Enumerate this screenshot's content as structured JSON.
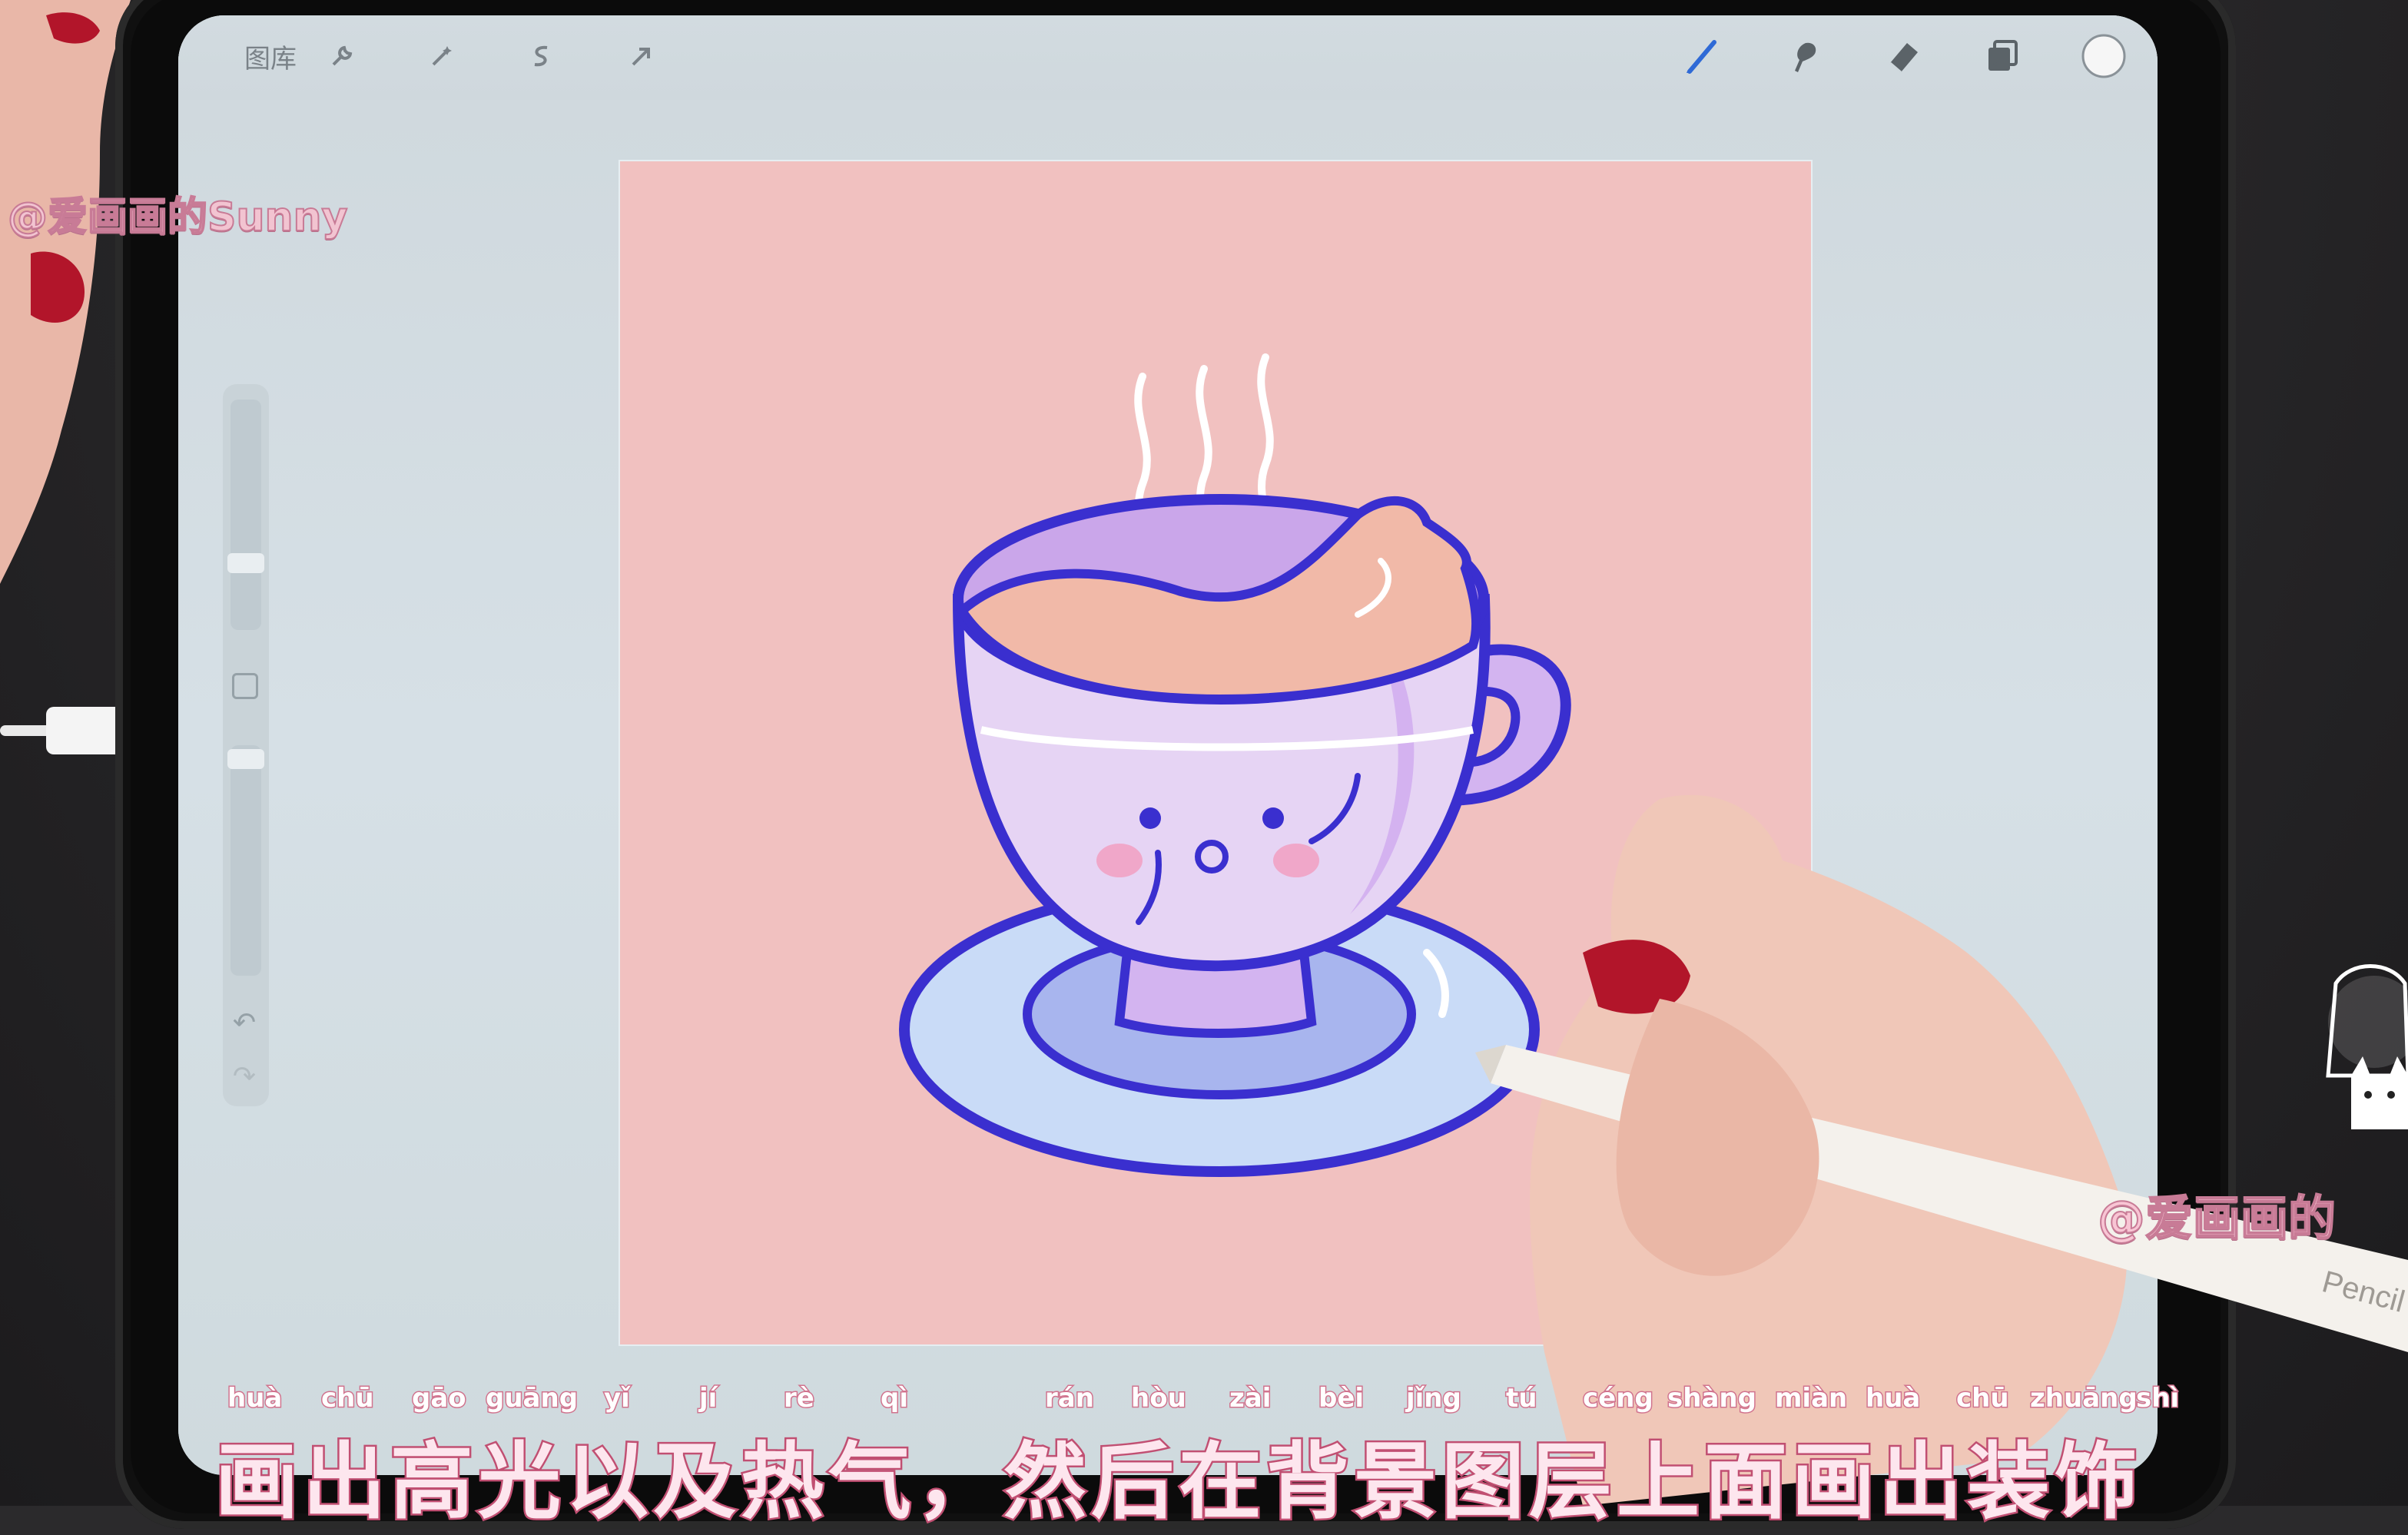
{
  "toolbar": {
    "gallery_label": "图库",
    "left_icons": [
      "wrench-icon",
      "magic-wand-icon",
      "selection-icon",
      "transform-arrow-icon"
    ],
    "right_icons": [
      "brush-icon",
      "smudge-icon",
      "eraser-icon",
      "layers-icon",
      "color-circle-icon"
    ]
  },
  "sidebar": {
    "undo_symbol": "↶",
    "redo_symbol": "↷"
  },
  "watermarks": {
    "top_left": "@爱画画的Sunny",
    "right": "@爱画画的"
  },
  "pencil_brand": "Pencil",
  "subtitle": {
    "text": "画出高光以及热气，然后在背景图层上面画出装饰",
    "pinyin": [
      "huà",
      "chū",
      "gāo",
      "guāng",
      "yǐ",
      "jí",
      "rè",
      "qì",
      "rán",
      "hòu",
      "zài",
      "bèi",
      "jǐng",
      "tú",
      "céng",
      "shàng",
      "miàn",
      "huà",
      "chū",
      "zhuāng",
      "shì"
    ]
  },
  "colors": {
    "canvas_bg": "#f1c1c0",
    "cup_outline": "#3a2fcf",
    "cup_body": "#e6d4f4",
    "saucer": "#c9dbf7",
    "tea": "#f1b9a8",
    "accent_pink": "#f0a7c9"
  }
}
